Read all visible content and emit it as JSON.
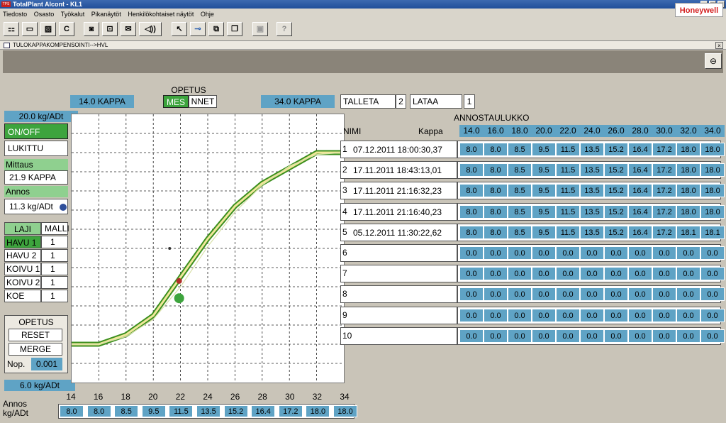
{
  "window": {
    "title": "TotalPlant Alcont - KL1",
    "logo": "TPS",
    "brand": "Honeywell"
  },
  "menu": [
    "Tiedosto",
    "Osasto",
    "Työkalut",
    "Pikanäytöt",
    "Henkilökohtaiset näytöt",
    "Ohje"
  ],
  "toolbar_icons": [
    "network-icon",
    "window-icon",
    "print-icon",
    "c-button",
    "camera-icon",
    "lock-icon",
    "mail-icon",
    "sound-icon",
    "pointer-icon",
    "key-icon",
    "window-restore-icon",
    "window-cascade-icon",
    "disabled-icon",
    "help-icon"
  ],
  "toolbar": {
    "c_label": "C"
  },
  "subwindow": {
    "title": "TULOKAPPAKOMPENSOINTI-->HVL",
    "close": "×"
  },
  "top": {
    "kappa_left": "14.0 KAPPA",
    "opetus_label": "OPETUS",
    "mes": "MES",
    "nnet": "NNET",
    "kappa_right": "34.0 KAPPA",
    "talleta": "TALLETA",
    "talleta_num": "2",
    "lataa": "LATAA",
    "lataa_num": "1"
  },
  "left": {
    "ymax": "20.0 kg/ADt",
    "onoff": "ON/OFF",
    "lukittu": "LUKITTU",
    "mittaus_label": "Mittaus",
    "mittaus_value": "21.9 KAPPA",
    "annos_label": "Annos",
    "annos_value": "11.3 kg/ADt",
    "laji_header": "LAJI",
    "malli_header": "MALLI",
    "laji": [
      {
        "name": "HAVU 1",
        "malli": "1"
      },
      {
        "name": "HAVU 2",
        "malli": "1"
      },
      {
        "name": "KOIVU 1",
        "malli": "1"
      },
      {
        "name": "KOIVU 2",
        "malli": "1"
      },
      {
        "name": "KOE",
        "malli": "1"
      }
    ],
    "opetus": "OPETUS",
    "reset": "RESET",
    "merge": "MERGE",
    "nop_label": "Nop.",
    "nop_value": "0.001",
    "ymin": "6.0 kg/ADt"
  },
  "chart_data": {
    "type": "line",
    "x_ticks": [
      14,
      16,
      18,
      20,
      22,
      24,
      26,
      28,
      30,
      32,
      34
    ],
    "xlim": [
      14,
      34
    ],
    "ylim": [
      6,
      20
    ],
    "series": [
      {
        "values": [
          8.0,
          8.0,
          8.5,
          9.5,
          11.5,
          13.5,
          15.2,
          16.4,
          17.2,
          18.0,
          18.0
        ],
        "color": "#3c8f1e"
      },
      {
        "values": [
          8.0,
          8.0,
          8.4,
          9.3,
          11.0,
          13.1,
          14.9,
          16.3,
          17.3,
          17.9,
          18.0
        ],
        "color": "#d8e0a8"
      }
    ],
    "points": [
      {
        "x": 21.9,
        "y": 10.4,
        "color": "#3da43d"
      },
      {
        "x": 21.9,
        "y": 11.3,
        "color": "#b0302a"
      },
      {
        "x": 21.2,
        "y": 13.0,
        "color": "#333333"
      }
    ]
  },
  "bottom": {
    "label": "Annos kg/ADt",
    "values": [
      "8.0",
      "8.0",
      "8.5",
      "9.5",
      "11.5",
      "13.5",
      "15.2",
      "16.4",
      "17.2",
      "18.0",
      "18.0"
    ]
  },
  "table": {
    "title": "ANNOSTAULUKKO",
    "nimi": "NIMI",
    "kappa": "Kappa",
    "columns": [
      "14.0",
      "16.0",
      "18.0",
      "20.0",
      "22.0",
      "24.0",
      "26.0",
      "28.0",
      "30.0",
      "32.0",
      "34.0"
    ],
    "rows": [
      {
        "num": "1",
        "name": "07.12.2011 18:00:30,37",
        "values": [
          "8.0",
          "8.0",
          "8.5",
          "9.5",
          "11.5",
          "13.5",
          "15.2",
          "16.4",
          "17.2",
          "18.0",
          "18.0"
        ]
      },
      {
        "num": "2",
        "name": "17.11.2011 18:43:13,01",
        "values": [
          "8.0",
          "8.0",
          "8.5",
          "9.5",
          "11.5",
          "13.5",
          "15.2",
          "16.4",
          "17.2",
          "18.0",
          "18.0"
        ]
      },
      {
        "num": "3",
        "name": "17.11.2011 21:16:32,23",
        "values": [
          "8.0",
          "8.0",
          "8.5",
          "9.5",
          "11.5",
          "13.5",
          "15.2",
          "16.4",
          "17.2",
          "18.0",
          "18.0"
        ]
      },
      {
        "num": "4",
        "name": "17.11.2011 21:16:40,23",
        "values": [
          "8.0",
          "8.0",
          "8.5",
          "9.5",
          "11.5",
          "13.5",
          "15.2",
          "16.4",
          "17.2",
          "18.0",
          "18.0"
        ]
      },
      {
        "num": "5",
        "name": "05.12.2011 11:30:22,62",
        "values": [
          "8.0",
          "8.0",
          "8.5",
          "9.5",
          "11.5",
          "13.5",
          "15.2",
          "16.4",
          "17.2",
          "18.1",
          "18.1"
        ]
      },
      {
        "num": "6",
        "name": "",
        "values": [
          "0.0",
          "0.0",
          "0.0",
          "0.0",
          "0.0",
          "0.0",
          "0.0",
          "0.0",
          "0.0",
          "0.0",
          "0.0"
        ]
      },
      {
        "num": "7",
        "name": "",
        "values": [
          "0.0",
          "0.0",
          "0.0",
          "0.0",
          "0.0",
          "0.0",
          "0.0",
          "0.0",
          "0.0",
          "0.0",
          "0.0"
        ]
      },
      {
        "num": "8",
        "name": "",
        "values": [
          "0.0",
          "0.0",
          "0.0",
          "0.0",
          "0.0",
          "0.0",
          "0.0",
          "0.0",
          "0.0",
          "0.0",
          "0.0"
        ]
      },
      {
        "num": "9",
        "name": "",
        "values": [
          "0.0",
          "0.0",
          "0.0",
          "0.0",
          "0.0",
          "0.0",
          "0.0",
          "0.0",
          "0.0",
          "0.0",
          "0.0"
        ]
      },
      {
        "num": "10",
        "name": "",
        "values": [
          "0.0",
          "0.0",
          "0.0",
          "0.0",
          "0.0",
          "0.0",
          "0.0",
          "0.0",
          "0.0",
          "0.0",
          "0.0"
        ]
      }
    ]
  }
}
